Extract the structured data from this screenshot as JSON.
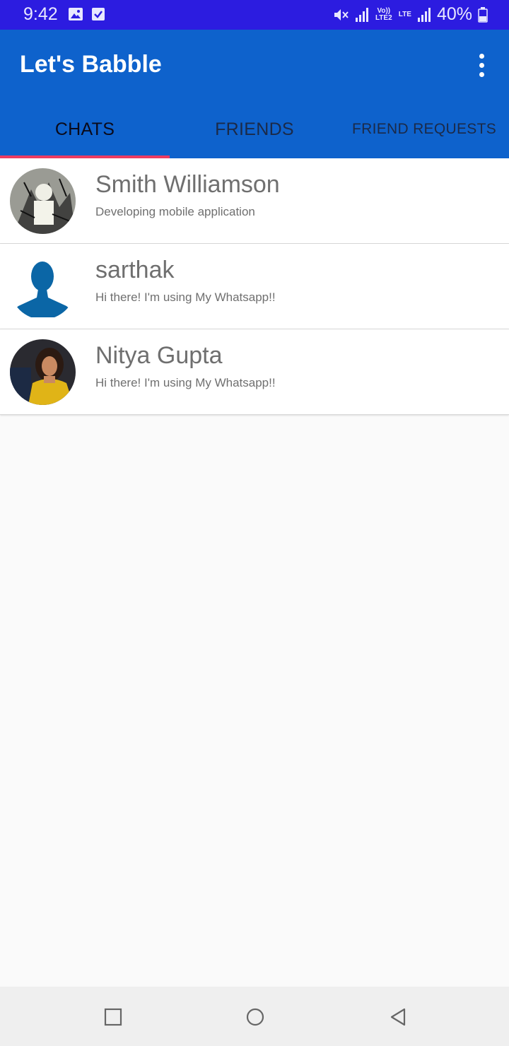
{
  "status_bar": {
    "time": "9:42",
    "left_icons": [
      "gallery-icon",
      "checkbox-icon"
    ],
    "volte_label": "Vo)) LTE2",
    "lte_label": "LTE",
    "battery_percent": "40%",
    "battery_level": 0.4
  },
  "app_bar": {
    "title": "Let's Babble",
    "tabs": [
      {
        "label": "CHATS",
        "active": true
      },
      {
        "label": "FRIENDS",
        "active": false
      },
      {
        "label": "FRIEND REQUESTS",
        "active": false
      }
    ]
  },
  "chats": [
    {
      "name": "Smith Williamson",
      "status": "Developing mobile application",
      "avatar": "sketch-photo-avatar"
    },
    {
      "name": "sarthak",
      "status": "Hi there! I'm using My Whatsapp!!",
      "avatar": "default-person-avatar"
    },
    {
      "name": "Nitya Gupta",
      "status": "Hi there! I'm using My Whatsapp!!",
      "avatar": "yellow-shirt-photo-avatar"
    }
  ],
  "colors": {
    "status_bar": "#2c1ce0",
    "app_bar": "#0e62cc",
    "tab_indicator": "#ec3c62",
    "background": "#fafafa"
  },
  "nav_bar": {
    "buttons": [
      "recents-square-icon",
      "home-circle-icon",
      "back-triangle-icon"
    ]
  }
}
